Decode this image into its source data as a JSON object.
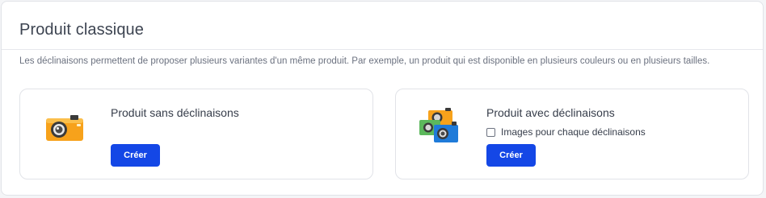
{
  "section": {
    "title": "Produit classique",
    "description": "Les déclinaisons permettent de proposer plusieurs variantes d'un même produit. Par exemple, un produit qui est disponible en plusieurs couleurs ou en plusieurs tailles."
  },
  "cards": [
    {
      "title": "Produit sans déclinaisons",
      "button_label": "Créer",
      "icon": "orange-camera-icon"
    },
    {
      "title": "Produit avec déclinaisons",
      "checkbox_label": "Images pour chaque déclinaisons",
      "checkbox_checked": false,
      "button_label": "Créer",
      "icon": "multi-color-cameras-icon"
    }
  ],
  "colors": {
    "primary_button": "#1447e6",
    "camera_orange": "#f7a21b",
    "camera_green": "#5cb85c",
    "camera_blue": "#1f7bd9"
  }
}
